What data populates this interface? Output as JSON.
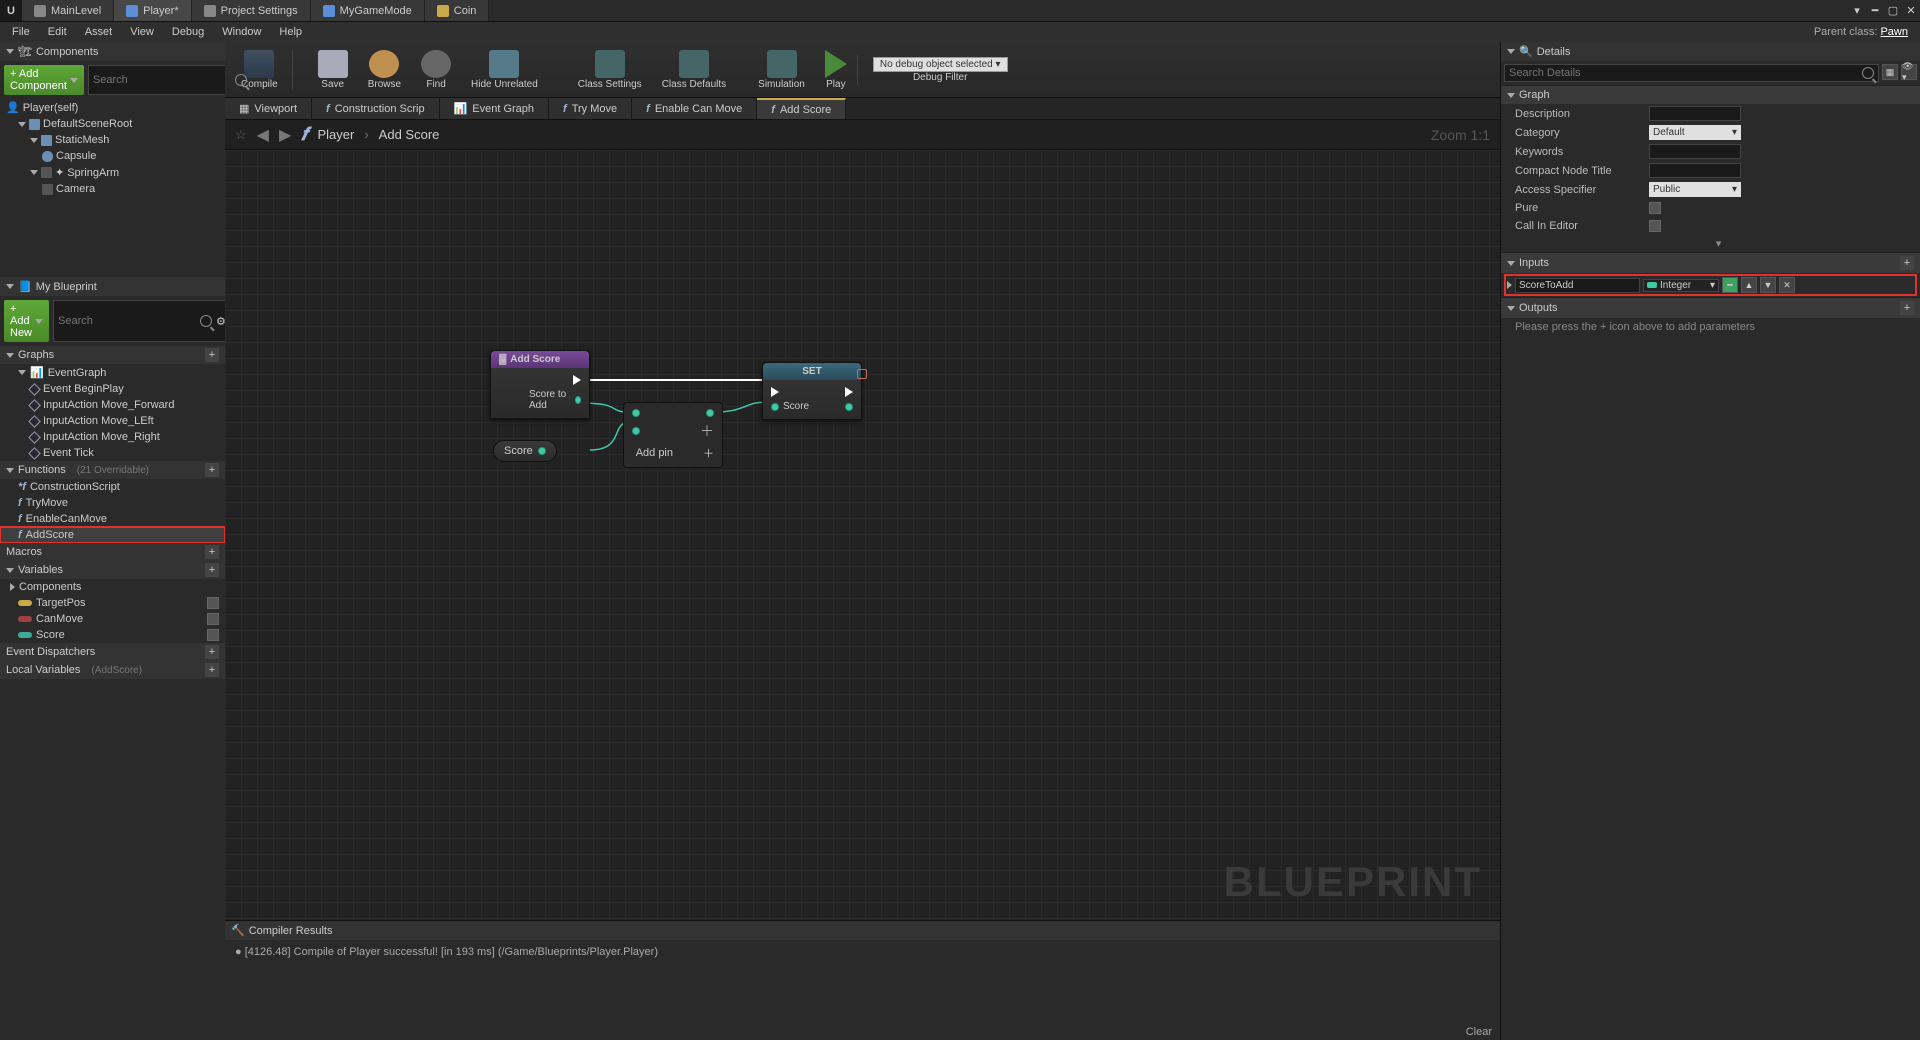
{
  "topTabs": [
    "MainLevel",
    "Player*",
    "Project Settings",
    "MyGameMode",
    "Coin"
  ],
  "activeTab": 1,
  "menu": [
    "File",
    "Edit",
    "Asset",
    "View",
    "Debug",
    "Window",
    "Help"
  ],
  "parentClass": {
    "label": "Parent class:",
    "value": "Pawn"
  },
  "componentsPanel": {
    "title": "Components",
    "addBtn": "+ Add Component",
    "searchPlaceholder": "Search",
    "root": "Player(self)",
    "tree": [
      {
        "name": "DefaultSceneRoot",
        "icon": "sphere",
        "depth": 1
      },
      {
        "name": "StaticMesh",
        "icon": "mesh",
        "depth": 2
      },
      {
        "name": "Capsule",
        "icon": "cap",
        "depth": 3
      },
      {
        "name": "SpringArm",
        "icon": "spring",
        "depth": 2
      },
      {
        "name": "Camera",
        "icon": "cam",
        "depth": 3
      }
    ]
  },
  "myBlueprint": {
    "title": "My Blueprint",
    "addBtn": "+ Add New",
    "searchPlaceholder": "Search",
    "graphs": {
      "label": "Graphs",
      "items": [
        "EventGraph",
        "Event BeginPlay",
        "InputAction Move_Forward",
        "InputAction Move_LEft",
        "InputAction Move_Right",
        "Event Tick"
      ]
    },
    "functions": {
      "label": "Functions",
      "sub": "(21 Overridable)",
      "items": [
        "ConstructionScript",
        "TryMove",
        "EnableCanMove",
        "AddScore"
      ],
      "selected": "AddScore"
    },
    "macros": {
      "label": "Macros"
    },
    "variables": {
      "label": "Variables",
      "sub": "Components",
      "items": [
        {
          "name": "TargetPos",
          "color": "yellow"
        },
        {
          "name": "CanMove",
          "color": "red"
        },
        {
          "name": "Score",
          "color": "teal"
        }
      ]
    },
    "eventDispatchers": {
      "label": "Event Dispatchers"
    },
    "localVars": {
      "label": "Local Variables",
      "sub": "(AddScore)"
    }
  },
  "toolbar": {
    "buttons": [
      "Compile",
      "Save",
      "Browse",
      "Find",
      "Hide Unrelated",
      "Class Settings",
      "Class Defaults",
      "Simulation",
      "Play"
    ],
    "debugSelect": "No debug object selected",
    "debugLabel": "Debug Filter"
  },
  "graphTabs": [
    "Viewport",
    "Construction Scrip",
    "Event Graph",
    "Try Move",
    "Enable Can Move",
    "Add Score"
  ],
  "activeGraphTab": "Add Score",
  "breadcrumb": {
    "root": "Player",
    "current": "Add Score",
    "zoom": "Zoom 1:1"
  },
  "nodes": {
    "entry": {
      "title": "Add Score",
      "pinOut": "Score to Add"
    },
    "set": {
      "title": "SET",
      "pinOut": "Score"
    },
    "scoreGet": {
      "label": "Score"
    },
    "addOp": {
      "addPin": "Add pin"
    }
  },
  "watermark": "BLUEPRINT",
  "compiler": {
    "title": "Compiler Results",
    "msg": "[4126.48] Compile of Player successful! [in 193 ms] (/Game/Blueprints/Player.Player)",
    "clear": "Clear"
  },
  "details": {
    "title": "Details",
    "searchPlaceholder": "Search Details",
    "graph": {
      "header": "Graph",
      "rows": [
        {
          "k": "Description",
          "type": "text",
          "v": ""
        },
        {
          "k": "Category",
          "type": "dd",
          "v": "Default"
        },
        {
          "k": "Keywords",
          "type": "text",
          "v": ""
        },
        {
          "k": "Compact Node Title",
          "type": "text",
          "v": ""
        },
        {
          "k": "Access Specifier",
          "type": "dd",
          "v": "Public"
        },
        {
          "k": "Pure",
          "type": "chk",
          "v": false
        },
        {
          "k": "Call In Editor",
          "type": "chk",
          "v": false
        }
      ]
    },
    "inputs": {
      "header": "Inputs",
      "param": {
        "name": "ScoreToAdd",
        "type": "Integer"
      }
    },
    "outputs": {
      "header": "Outputs",
      "hint": "Please press the + icon above to add parameters"
    }
  }
}
